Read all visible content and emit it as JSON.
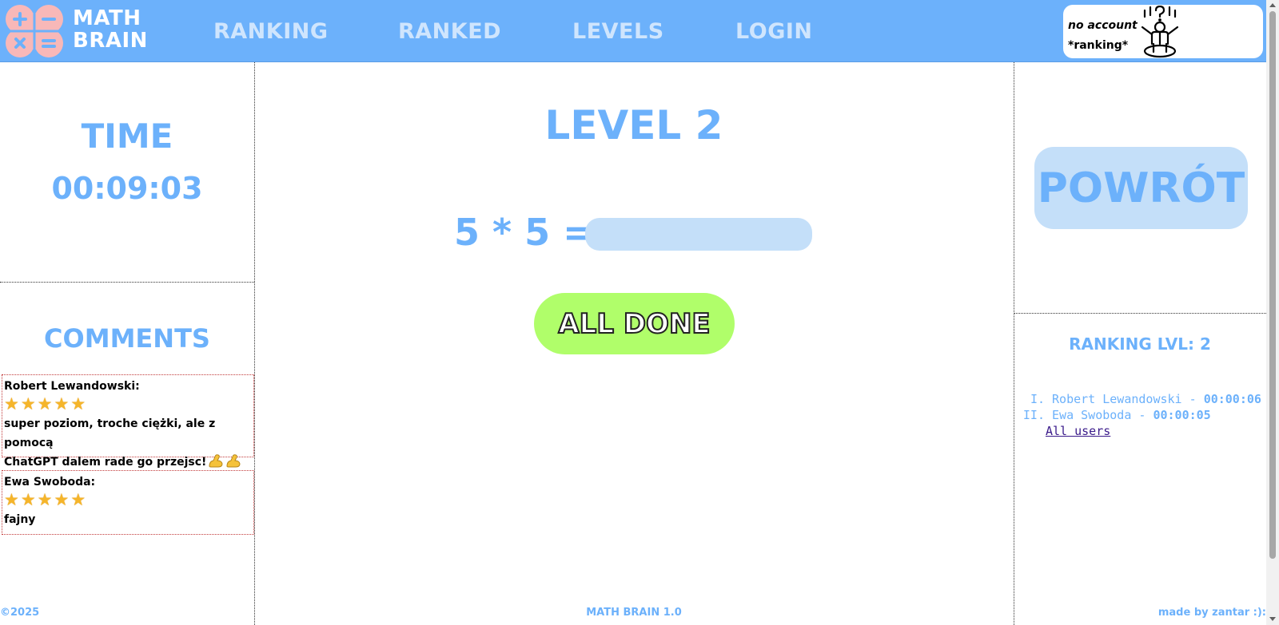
{
  "header": {
    "logo_line1": "MATH",
    "logo_line2": "BRAIN",
    "nav": [
      "RANKING",
      "RANKED",
      "LEVELS",
      "LOGIN"
    ],
    "account_line1": "no account",
    "account_line2": "*ranking*"
  },
  "timer": {
    "title": "TIME",
    "value": "00:09:03"
  },
  "comments": {
    "title": "COMMENTS",
    "items": [
      {
        "author": "Robert Lewandowski:",
        "rating": 5,
        "text_line1": "super poziom, troche ciężki, ale z pomocą",
        "text_line2": "ChatGPT dalem rade go przejsc!"
      },
      {
        "author": "Ewa Swoboda:",
        "rating": 5,
        "text_line1": "fajny"
      }
    ]
  },
  "game": {
    "level_title": "LEVEL 2",
    "equation": "5 * 5 =",
    "answer_value": "",
    "done_label": "ALL DONE"
  },
  "sidebar_right": {
    "back_label": "POWRÓT",
    "ranking_title": "RANKING LVL: 2",
    "ranking": [
      {
        "rank": "I.",
        "name": "Robert Lewandowski",
        "time": "00:00:06"
      },
      {
        "rank": "II.",
        "name": "Ewa Swoboda",
        "time": "00:00:05"
      }
    ],
    "all_users_label": "All users"
  },
  "footer": {
    "left": "©2025",
    "center": "MATH BRAIN 1.0",
    "right": "made by zantar :):"
  },
  "colors": {
    "header_bg": "#6cb1fb",
    "accent_blue": "#6cb1fb",
    "light_blue": "#c4dff9",
    "done_green": "#b0fe6a",
    "logo_pink": "#f8b8b8"
  }
}
